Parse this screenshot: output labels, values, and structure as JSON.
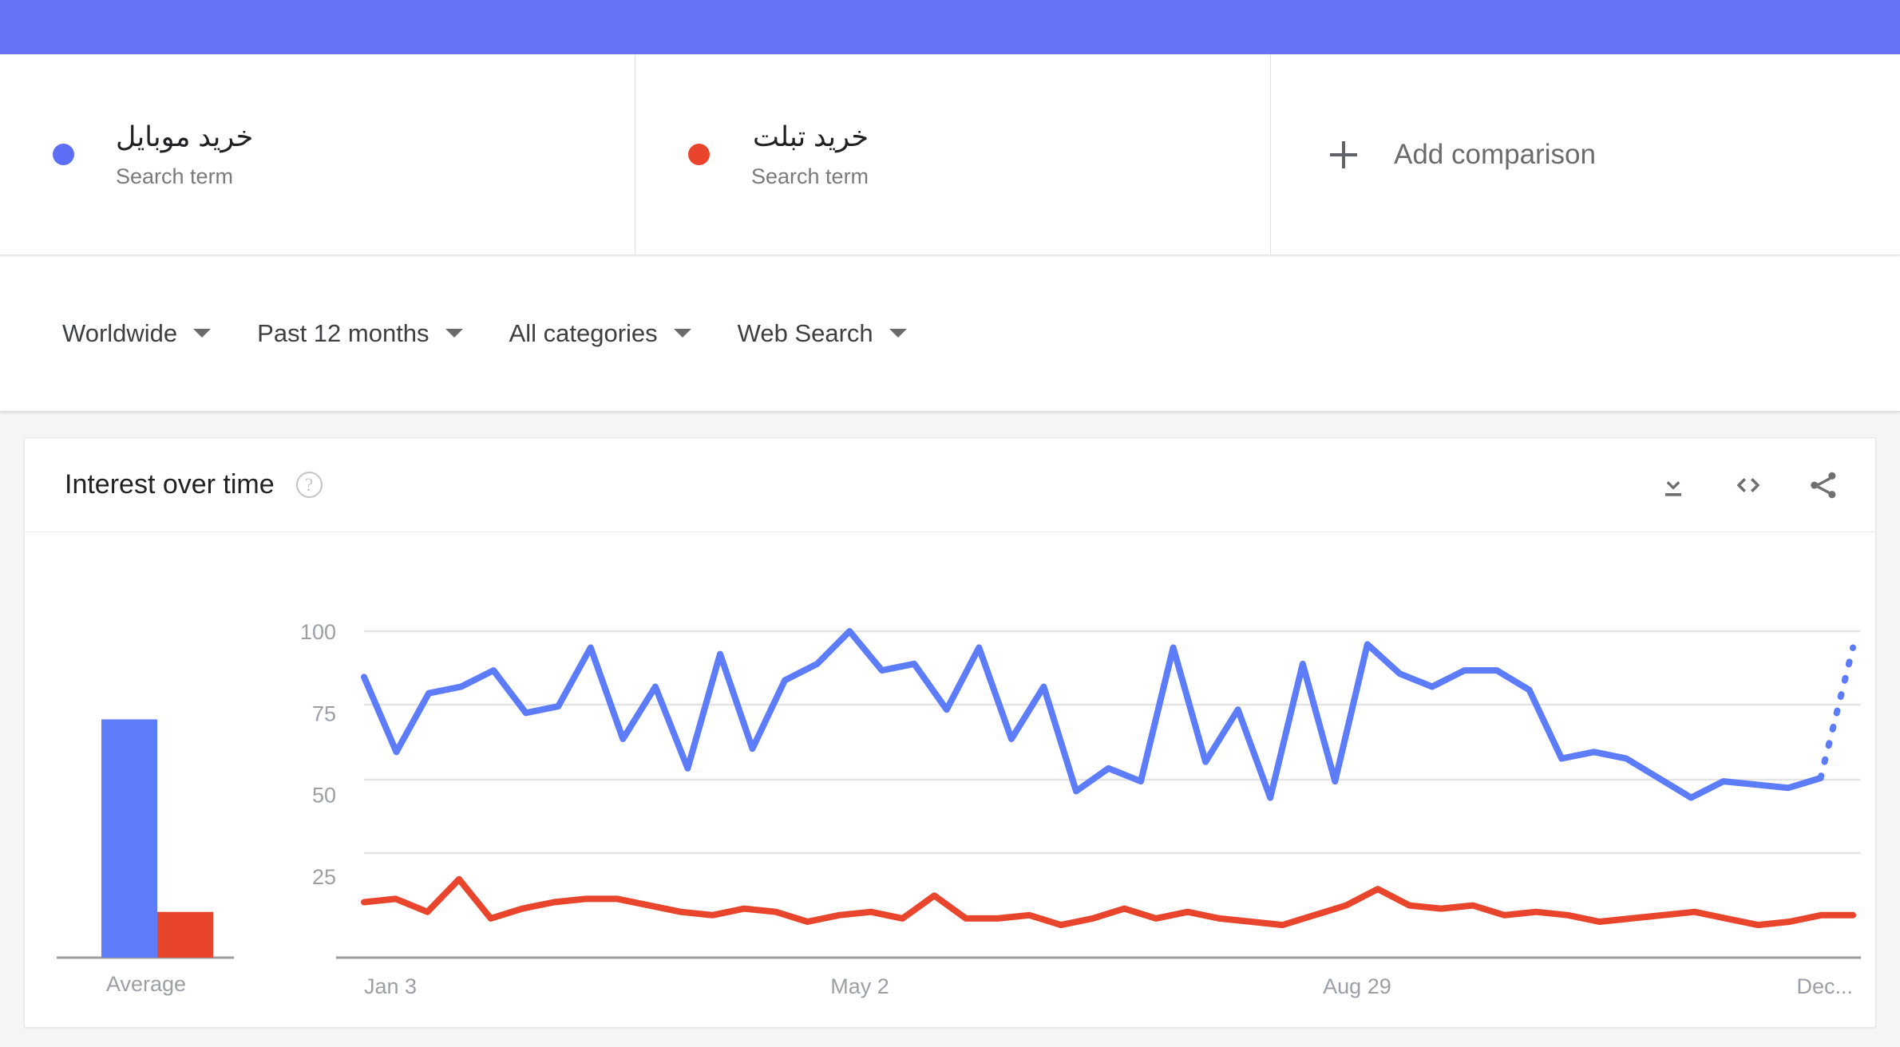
{
  "theme": {
    "accent_bar": "#6673f7",
    "series_blue": "#5c7cfa",
    "series_red": "#e8452c",
    "legend_blue": "#5b6ef5",
    "page_bg": "#f5f5f5"
  },
  "terms": [
    {
      "label": "خرید موبایل",
      "type_label": "Search term",
      "color": "#5b6ef5",
      "dot_name": "legend-dot-blue"
    },
    {
      "label": "خرید تبلت",
      "type_label": "Search term",
      "color": "#e8452c",
      "dot_name": "legend-dot-red"
    }
  ],
  "add_comparison": {
    "label": "Add comparison",
    "icon": "plus-icon"
  },
  "filters": [
    {
      "label": "Worldwide",
      "icon": "chevron-down-icon"
    },
    {
      "label": "Past 12 months",
      "icon": "chevron-down-icon"
    },
    {
      "label": "All categories",
      "icon": "chevron-down-icon"
    },
    {
      "label": "Web Search",
      "icon": "chevron-down-icon"
    }
  ],
  "card": {
    "title": "Interest over time",
    "help_icon": "?",
    "actions": [
      {
        "name": "download-icon",
        "label": "Download"
      },
      {
        "name": "embed-code-icon",
        "label": "Embed"
      },
      {
        "name": "share-icon",
        "label": "Share"
      }
    ]
  },
  "chart_data": {
    "type": "line",
    "title": "Interest over time",
    "xlabel": "",
    "ylabel": "",
    "ylim": [
      0,
      105
    ],
    "grid": true,
    "legend_position": "top",
    "y_ticks": [
      100,
      75,
      50,
      25
    ],
    "x_tick_labels": [
      "Jan 3",
      "May 2",
      "Aug 29",
      "Dec..."
    ],
    "x_tick_positions": [
      0,
      0.333,
      0.667,
      1.0
    ],
    "partial_data_dashed_tail": true,
    "series": [
      {
        "name": "خرید موبایل",
        "color": "#5c7cfa",
        "values": [
          86,
          63,
          81,
          83,
          88,
          75,
          77,
          95,
          67,
          83,
          58,
          93,
          64,
          85,
          90,
          100,
          88,
          90,
          76,
          95,
          67,
          83,
          51,
          58,
          54,
          95,
          60,
          76,
          49,
          90,
          54,
          96,
          87,
          83,
          88,
          88,
          82,
          61,
          63,
          61,
          55,
          49,
          54,
          53,
          52,
          55
        ],
        "partial_tail": [
          55,
          95
        ]
      },
      {
        "name": "خرید تبلت",
        "color": "#e8452c",
        "values": [
          17,
          18,
          14,
          24,
          12,
          15,
          17,
          18,
          18,
          16,
          14,
          13,
          15,
          14,
          11,
          13,
          14,
          12,
          19,
          12,
          12,
          13,
          10,
          12,
          15,
          12,
          14,
          12,
          11,
          10,
          13,
          16,
          21,
          16,
          15,
          16,
          13,
          14,
          13,
          11,
          12,
          13,
          14,
          12,
          10,
          11,
          13,
          13
        ]
      }
    ],
    "average_bar_chart": {
      "type": "bar",
      "category_label": "Average",
      "bars": [
        {
          "name": "خرید موبایل",
          "value": 73,
          "color": "#5c7cfa"
        },
        {
          "name": "خرید تبلت",
          "value": 14,
          "color": "#e8452c"
        }
      ]
    }
  }
}
